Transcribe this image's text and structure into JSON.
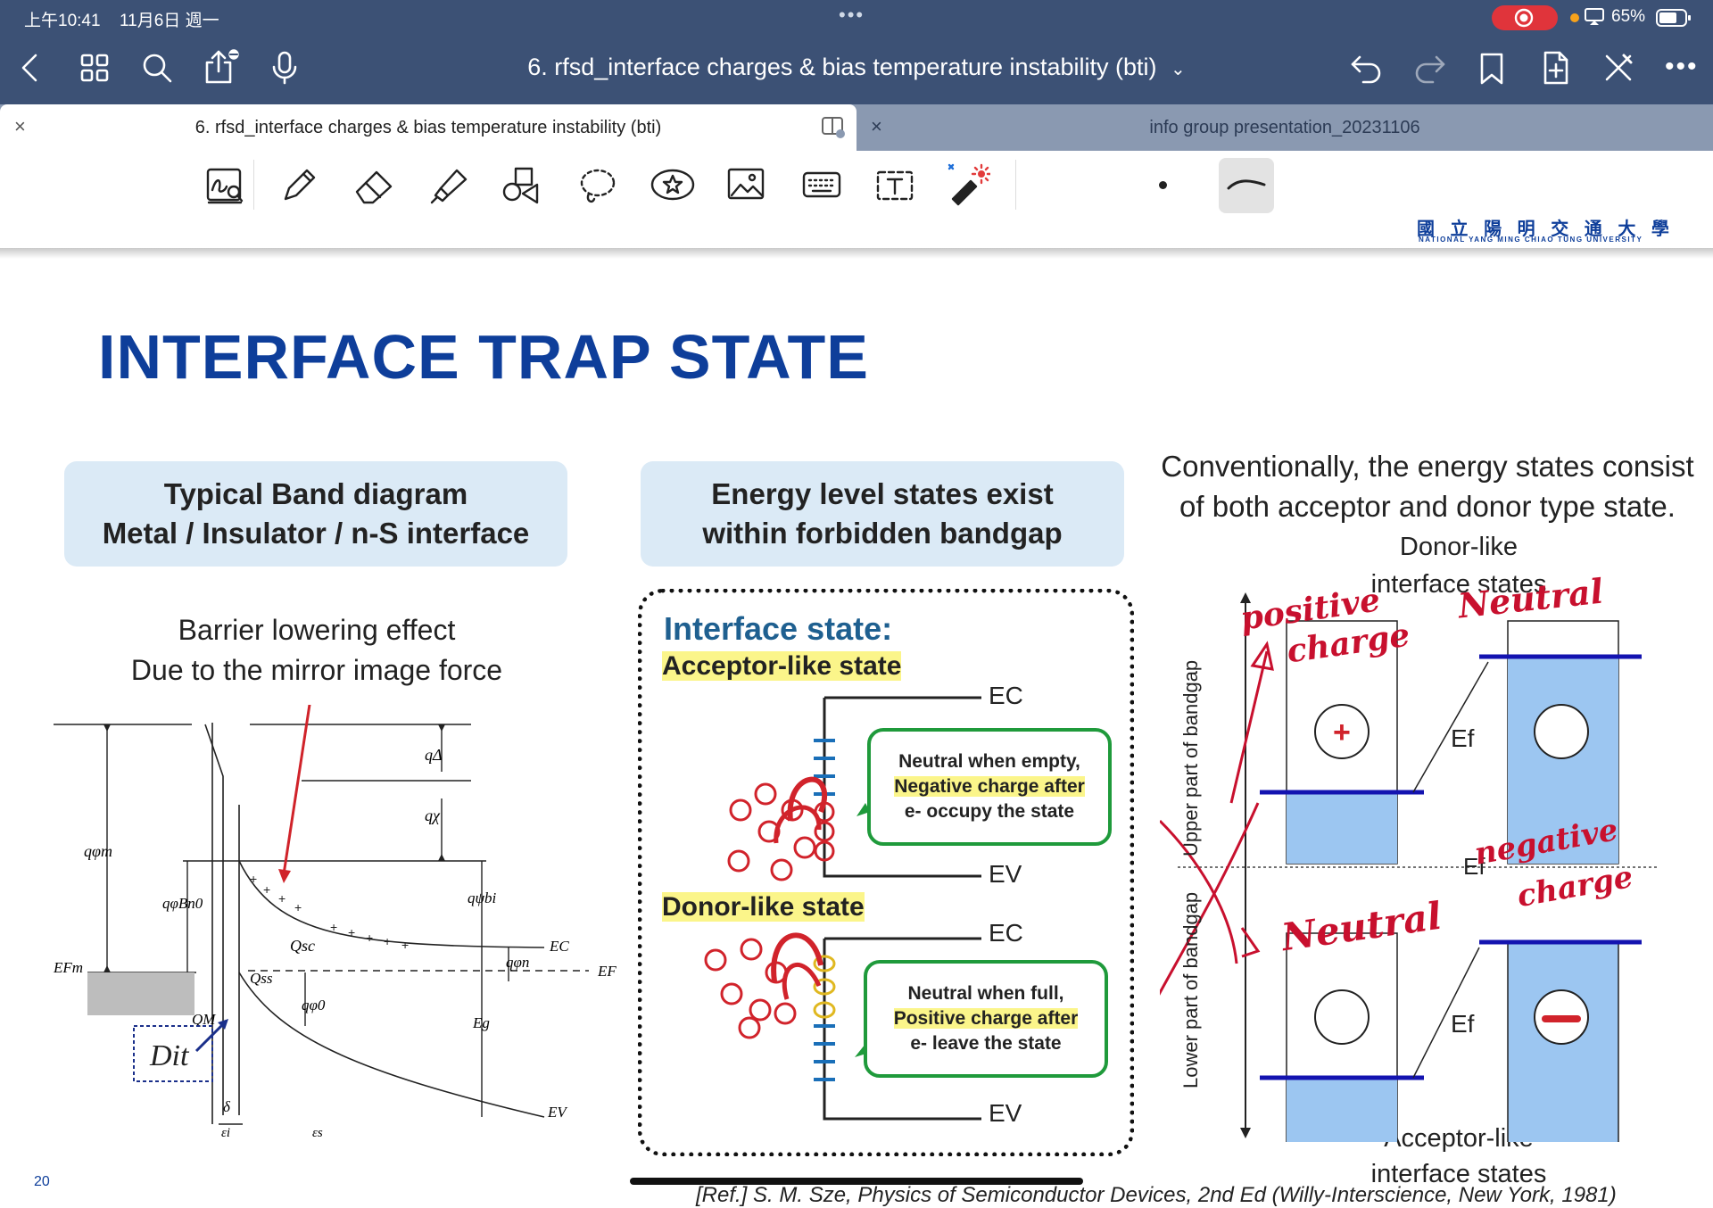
{
  "status_bar": {
    "time": "上午10:41",
    "date": "11月6日 週一",
    "dots": "•••",
    "battery": "65%"
  },
  "nav": {
    "document_title": "6. rfsd_interface charges & bias temperature instability (bti)",
    "title_chevron": "⌄"
  },
  "tabs": [
    {
      "label": "6. rfsd_interface charges & bias temperature instability (bti)",
      "active": true
    },
    {
      "label": "info group presentation_20231106",
      "active": false
    }
  ],
  "toolbar": {
    "tools": [
      "handwriting-zoom",
      "pen",
      "eraser",
      "highlighter",
      "shapes",
      "lasso",
      "sticker",
      "image",
      "keyboard",
      "text",
      "laser-pointer",
      "dot",
      "stroke-preview"
    ]
  },
  "slide": {
    "university_logo": "國 立 陽 明 交 通 大 學",
    "university_sub": "NATIONAL YANG MING CHIAO TUNG UNIVERSITY",
    "title": "INTERFACE TRAP STATE",
    "box1": {
      "line1": "Typical Band diagram",
      "line2": "Metal / Insulator / n-S interface"
    },
    "box2": {
      "line1": "Energy level states exist",
      "line2": "within forbidden bandgap"
    },
    "right_text": {
      "line1": "Conventionally, the energy states consist",
      "line2": "of both acceptor and donor type state."
    },
    "barrier": {
      "line1": "Barrier lowering effect",
      "line2": "Due to the mirror image force"
    },
    "band_labels": {
      "q_delta": "qΔ",
      "q_chi": "qχ",
      "q_phi_m": "qφm",
      "q_phi_bn0": "qφBn0",
      "q_psi_bi": "qψbi",
      "q_phi_n": "qφn",
      "e_c": "EC",
      "e_f": "EF",
      "e_fm": "EFm",
      "q_sc": "Qsc",
      "q_ss": "Qss",
      "q_m": "QM",
      "q_phi0": "qφ0",
      "e_g": "Eg",
      "e_v": "EV",
      "delta": "δ",
      "eps_i": "εi",
      "eps_s": "εs",
      "dit": "Dit"
    },
    "interface": {
      "title": "Interface state:",
      "acceptor": "Acceptor-like state",
      "donor": "Donor-like state",
      "ec_top": "EC",
      "ev_top": "EV",
      "ec_bot": "EC",
      "ev_bot": "EV",
      "callout_top": {
        "line1": "Neutral when empty,",
        "line2": "Negative charge after",
        "line3": "e- occupy the state"
      },
      "callout_bot": {
        "line1": "Neutral when full,",
        "line2": "Positive charge after",
        "line3": "e- leave the state"
      }
    },
    "states": {
      "donor_title1": "Donor-like",
      "donor_title2": "interface states",
      "acceptor_title1": "Acceptor-like",
      "acceptor_title2": "interface states",
      "axis_upper": "Upper part of bandgap",
      "axis_lower": "Lower part of bandgap",
      "ef_1": "Ef",
      "ef_2": "Ef",
      "ef_mid": "Ef",
      "plus": "+"
    },
    "annotations": {
      "positive_charge_1": "positive",
      "positive_charge_2": "charge",
      "neutral_top": "Neutral",
      "negative_charge_1": "negative",
      "negative_charge_2": "charge",
      "neutral_bottom": "Neutral"
    },
    "page_number": "20",
    "reference": "[Ref.] S. M. Sze, Physics of Semiconductor Devices, 2nd Ed (Willy-Interscience, New York, 1981)"
  }
}
